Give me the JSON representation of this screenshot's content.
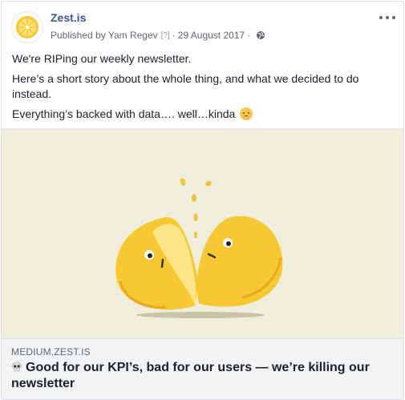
{
  "post": {
    "page_name": "Zest.is",
    "meta": {
      "published_by": "Published by Yam Regev",
      "help_marker": "[?]",
      "separator": "·",
      "date": "29 August 2017",
      "privacy_icon": "globe-icon"
    },
    "body": [
      "We're RIPing our weekly newsletter.",
      "Here’s a short story about the whole thing, and what we decided to do instead.",
      "Everything’s backed with data…. well…kinda"
    ],
    "emoji": "worried-face-icon",
    "more_icon": "more-options-icon"
  },
  "link_preview": {
    "domain": "MEDIUM.ZEST.IS",
    "skull_icon": "skull-icon",
    "headline": "Good for our KPI’s, bad for our users — we’re killing our newsletter"
  },
  "colors": {
    "page_name": "#385898",
    "media_bg": "#efeedd",
    "lemon": "#f7c832",
    "link_bg": "#f2f3f5"
  }
}
